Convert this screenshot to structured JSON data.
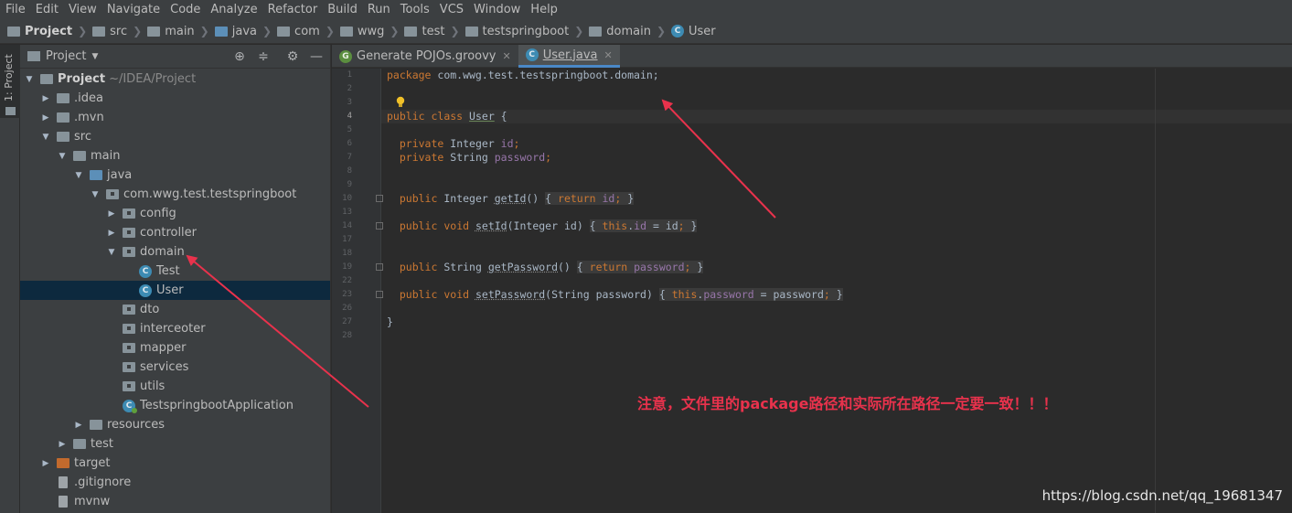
{
  "menu": [
    "File",
    "Edit",
    "View",
    "Navigate",
    "Code",
    "Analyze",
    "Refactor",
    "Build",
    "Run",
    "Tools",
    "VCS",
    "Window",
    "Help"
  ],
  "breadcrumb": [
    "Project",
    "src",
    "main",
    "java",
    "com",
    "wwg",
    "test",
    "testspringboot",
    "domain",
    "User"
  ],
  "toolstrip": {
    "label": "1: Project"
  },
  "panel": {
    "title": "Project"
  },
  "tree": [
    {
      "label": "Project",
      "suffix": "~/IDEA/Project",
      "bold": true
    },
    {
      "label": ".idea"
    },
    {
      "label": ".mvn"
    },
    {
      "label": "src"
    },
    {
      "label": "main"
    },
    {
      "label": "java"
    },
    {
      "label": "com.wwg.test.testspringboot"
    },
    {
      "label": "config"
    },
    {
      "label": "controller"
    },
    {
      "label": "domain"
    },
    {
      "label": "Test"
    },
    {
      "label": "User",
      "selected": true
    },
    {
      "label": "dto"
    },
    {
      "label": "interceoter"
    },
    {
      "label": "mapper"
    },
    {
      "label": "services"
    },
    {
      "label": "utils"
    },
    {
      "label": "TestspringbootApplication"
    },
    {
      "label": "resources"
    },
    {
      "label": "test"
    },
    {
      "label": "target"
    },
    {
      "label": ".gitignore"
    },
    {
      "label": "mvnw"
    }
  ],
  "tabs": [
    {
      "label": "Generate POJOs.groovy",
      "icon": "groovy-icon",
      "active": false
    },
    {
      "label": "User.java",
      "icon": "java-class-icon",
      "active": true
    }
  ],
  "editor": {
    "line_numbers": [
      "1",
      "2",
      "3",
      "4",
      "5",
      "6",
      "7",
      "8",
      "9",
      "10",
      "13",
      "14",
      "17",
      "18",
      "19",
      "22",
      "23",
      "26",
      "27",
      "28"
    ],
    "current_line": "4",
    "code": {
      "package_kw": "package",
      "package_name": " com.wwg.test.testspringboot.domain;",
      "public": "public",
      "class": "class",
      "class_name": "User",
      "private": "private",
      "integer": "Integer",
      "string": "String",
      "id": "id",
      "password": "password",
      "void": "void",
      "return": "return",
      "this": "this",
      "getId": "getId",
      "setId": "setId",
      "getPassword": "getPassword",
      "setPassword": "setPassword"
    }
  },
  "annotation": "注意，文件里的package路径和实际所在路径一定要一致！！！",
  "watermark": "https://blog.csdn.net/qq_19681347",
  "colors": {
    "arrow": "#e8324c",
    "accent": "#4a88c7",
    "keyword": "#cc7832",
    "field": "#9876aa"
  }
}
